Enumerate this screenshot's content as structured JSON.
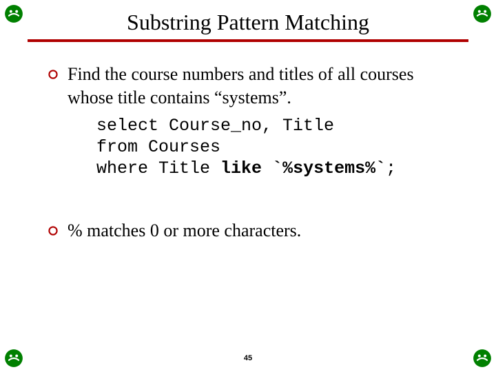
{
  "title": "Substring Pattern Matching",
  "bullets": [
    {
      "text": "Find the course numbers and titles of all courses whose title contains “systems”."
    },
    {
      "text": "% matches 0 or more characters."
    }
  ],
  "code": {
    "line1a": "select Course_no, Title",
    "line2a": "from Courses",
    "line3a": "where Title ",
    "like": "like",
    "space": " ",
    "pattern": "`%systems%`",
    "semicolon": ";"
  },
  "page_number": "45",
  "colors": {
    "rule": "#b00000",
    "bullet": "#b00000",
    "corner": "#008000"
  }
}
